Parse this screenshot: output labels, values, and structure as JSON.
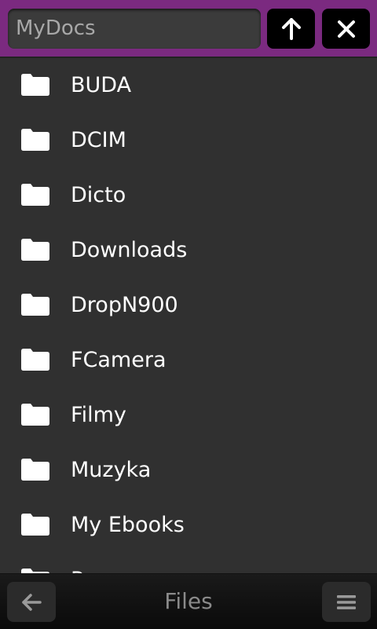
{
  "header": {
    "path_value": "MyDocs",
    "up_icon": "arrow-up-icon",
    "close_icon": "close-icon"
  },
  "files": [
    {
      "name": "BUDA",
      "icon": "folder-icon"
    },
    {
      "name": "DCIM",
      "icon": "folder-icon"
    },
    {
      "name": "Dicto",
      "icon": "folder-icon"
    },
    {
      "name": "Downloads",
      "icon": "folder-icon"
    },
    {
      "name": "DropN900",
      "icon": "folder-icon"
    },
    {
      "name": "FCamera",
      "icon": "folder-icon"
    },
    {
      "name": "Filmy",
      "icon": "folder-icon"
    },
    {
      "name": "Muzyka",
      "icon": "folder-icon"
    },
    {
      "name": "My Ebooks",
      "icon": "folder-icon"
    },
    {
      "name": "Panorama",
      "icon": "folder-icon"
    }
  ],
  "footer": {
    "title": "Files",
    "back_icon": "arrow-left-icon",
    "menu_icon": "menu-icon"
  },
  "colors": {
    "accent": "#7b2a80",
    "background": "#303030"
  }
}
